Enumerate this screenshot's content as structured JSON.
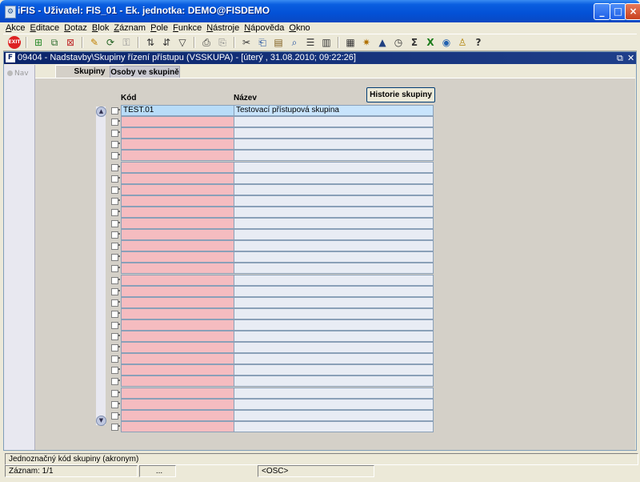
{
  "window": {
    "title": "iFIS - Uživatel: FIS_01 - Ek. jednotka: DEMO@FISDEMO"
  },
  "menu": [
    {
      "first": "A",
      "rest": "kce"
    },
    {
      "first": "E",
      "rest": "ditace"
    },
    {
      "first": "D",
      "rest": "otaz"
    },
    {
      "first": "B",
      "rest": "lok"
    },
    {
      "first": "Z",
      "rest": "áznam"
    },
    {
      "first": "P",
      "rest": "ole"
    },
    {
      "first": "F",
      "rest": "unkce"
    },
    {
      "first": "N",
      "rest": "ástroje"
    },
    {
      "first": "N",
      "rest": "ápověda"
    },
    {
      "first": "O",
      "rest": "kno"
    }
  ],
  "toolbar": {
    "exit_label": "EXIT"
  },
  "form": {
    "title": "09404 - Nadstavby\\Skupiny řízení přístupu (VSSKUPA) - [úterý  , 31.08.2010; 09:22:26]",
    "nav_label": "Nav",
    "tabs": [
      "Skupiny",
      "Osoby ve skupině"
    ],
    "col_kod": "Kód",
    "col_nazev": "Název",
    "history_button": "Historie skupiny",
    "rows": [
      {
        "kod": "TEST.01",
        "nazev": "Testovací přístupová skupina"
      }
    ],
    "empty_rows": 28
  },
  "status": {
    "hint": "Jednoznačný kód skupiny (akronym)",
    "record": "Záznam: 1/1",
    "ellipsis": "...",
    "osc": "<OSC>"
  }
}
